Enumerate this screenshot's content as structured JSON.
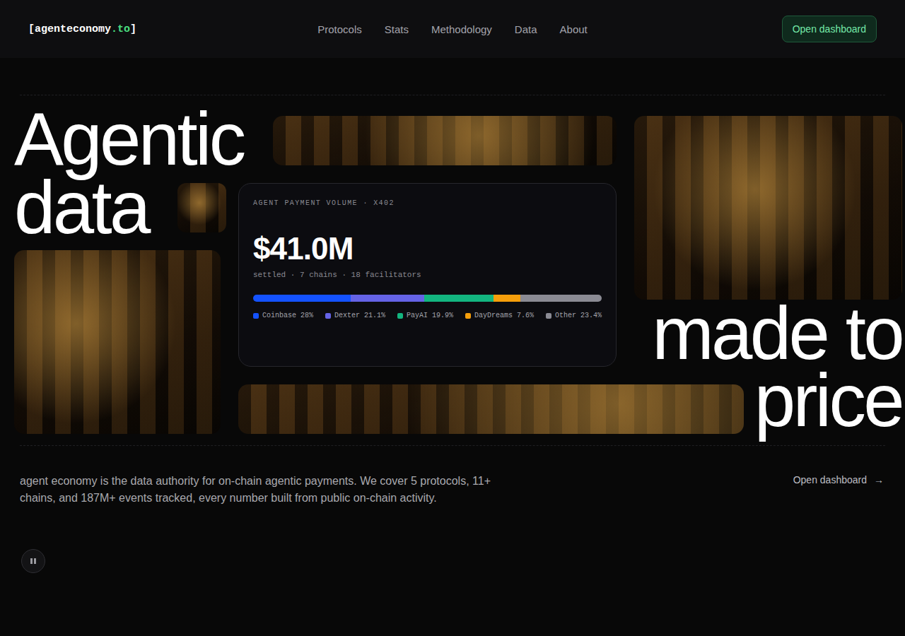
{
  "nav": {
    "logo": [
      {
        "text": "[",
        "accent": false
      },
      {
        "text": "agenteconomy",
        "accent": false
      },
      {
        "text": ".to",
        "accent": true
      },
      {
        "text": "]",
        "accent": false
      }
    ],
    "links": [
      "Protocols",
      "Stats",
      "Methodology",
      "Data",
      "About"
    ],
    "cta": "Open dashboard"
  },
  "hero": {
    "headline_top": [
      "Agentic",
      "data"
    ],
    "headline_bottom": [
      "made to",
      "price"
    ],
    "card": {
      "label": "AGENT PAYMENT VOLUME · X402",
      "value": "$41.0M",
      "subtitle": "settled · 7 chains · 18 facilitators",
      "segments": [
        {
          "label": "Coinbase 28%",
          "level": 0.28,
          "color": "#1452ff"
        },
        {
          "label": "Dexter 21.1%",
          "level": 0.211,
          "color": "#6563e6"
        },
        {
          "label": "PayAI 19.9%",
          "level": 0.199,
          "color": "#13b57f"
        },
        {
          "label": "DayDreams 7.6%",
          "level": 0.076,
          "color": "#f59e0b"
        },
        {
          "label": "Other 23.4%",
          "level": 0.234,
          "color": "#8b8b94"
        }
      ]
    }
  },
  "intro": {
    "text": "agent economy is the data authority for on-chain agentic payments. We cover 5 protocols, 11+ chains, and 187M+ events tracked, every number built from public on-chain activity.",
    "link": "Open dashboard",
    "link_icon": "→"
  },
  "player": {
    "playing": true
  }
}
